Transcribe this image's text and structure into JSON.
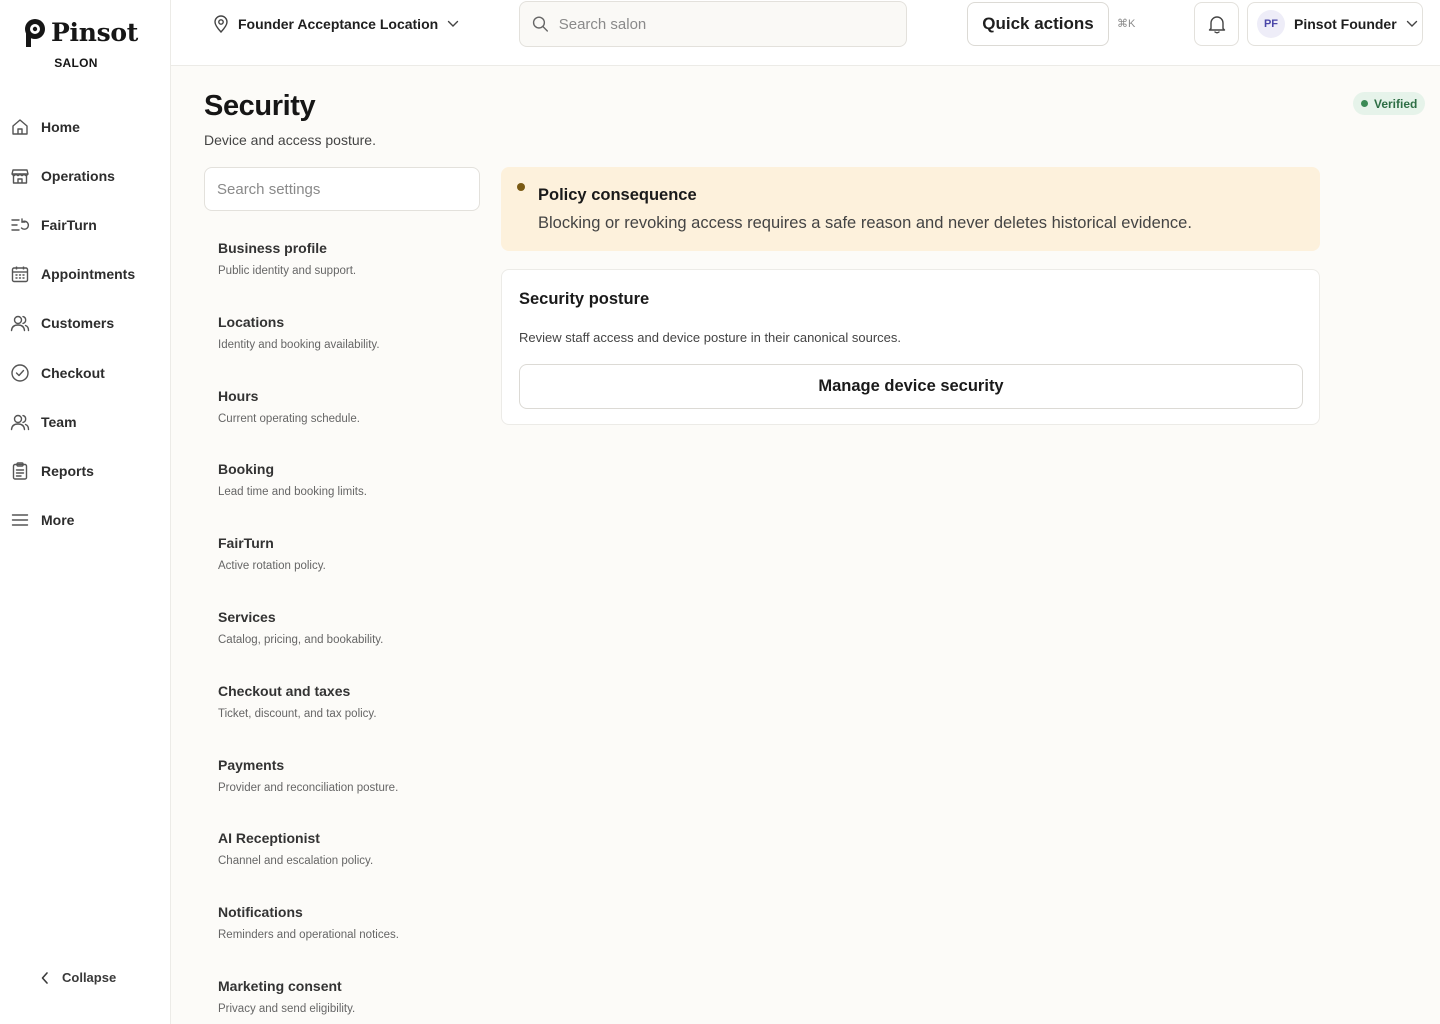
{
  "brand": {
    "name": "Pinsot",
    "subtitle": "SALON"
  },
  "sidebar": {
    "items": [
      {
        "label": "Home",
        "icon": "home-icon"
      },
      {
        "label": "Operations",
        "icon": "store-icon"
      },
      {
        "label": "FairTurn",
        "icon": "rotation-icon"
      },
      {
        "label": "Appointments",
        "icon": "calendar-icon"
      },
      {
        "label": "Customers",
        "icon": "users-icon"
      },
      {
        "label": "Checkout",
        "icon": "check-circle-icon"
      },
      {
        "label": "Team",
        "icon": "team-icon"
      },
      {
        "label": "Reports",
        "icon": "clipboard-icon"
      },
      {
        "label": "More",
        "icon": "menu-icon"
      }
    ],
    "collapse_label": "Collapse"
  },
  "topbar": {
    "location": "Founder Acceptance Location",
    "search_placeholder": "Search salon",
    "quick_actions": "Quick actions",
    "shortcut": "⌘K",
    "user_initials": "PF",
    "user_name": "Pinsot Founder"
  },
  "page": {
    "title": "Security",
    "subtitle": "Device and access posture.",
    "status": "Verified"
  },
  "settings": {
    "search_placeholder": "Search settings",
    "items": [
      {
        "title": "Business profile",
        "desc": "Public identity and support."
      },
      {
        "title": "Locations",
        "desc": "Identity and booking availability."
      },
      {
        "title": "Hours",
        "desc": "Current operating schedule."
      },
      {
        "title": "Booking",
        "desc": "Lead time and booking limits."
      },
      {
        "title": "FairTurn",
        "desc": "Active rotation policy."
      },
      {
        "title": "Services",
        "desc": "Catalog, pricing, and bookability."
      },
      {
        "title": "Checkout and taxes",
        "desc": "Ticket, discount, and tax policy."
      },
      {
        "title": "Payments",
        "desc": "Provider and reconciliation posture."
      },
      {
        "title": "AI Receptionist",
        "desc": "Channel and escalation policy."
      },
      {
        "title": "Notifications",
        "desc": "Reminders and operational notices."
      },
      {
        "title": "Marketing consent",
        "desc": "Privacy and send eligibility."
      }
    ]
  },
  "policy": {
    "title": "Policy consequence",
    "text": "Blocking or revoking access requires a safe reason and never deletes historical evidence."
  },
  "posture": {
    "title": "Security posture",
    "text": "Review staff access and device posture in their canonical sources.",
    "button": "Manage device security"
  },
  "colors": {
    "accent_warning_bg": "#fdf1dc",
    "verified_bg": "#e6f3ea",
    "verified_text": "#2e6e45",
    "avatar_bg": "#eeedf8",
    "avatar_text": "#4a46a8"
  }
}
